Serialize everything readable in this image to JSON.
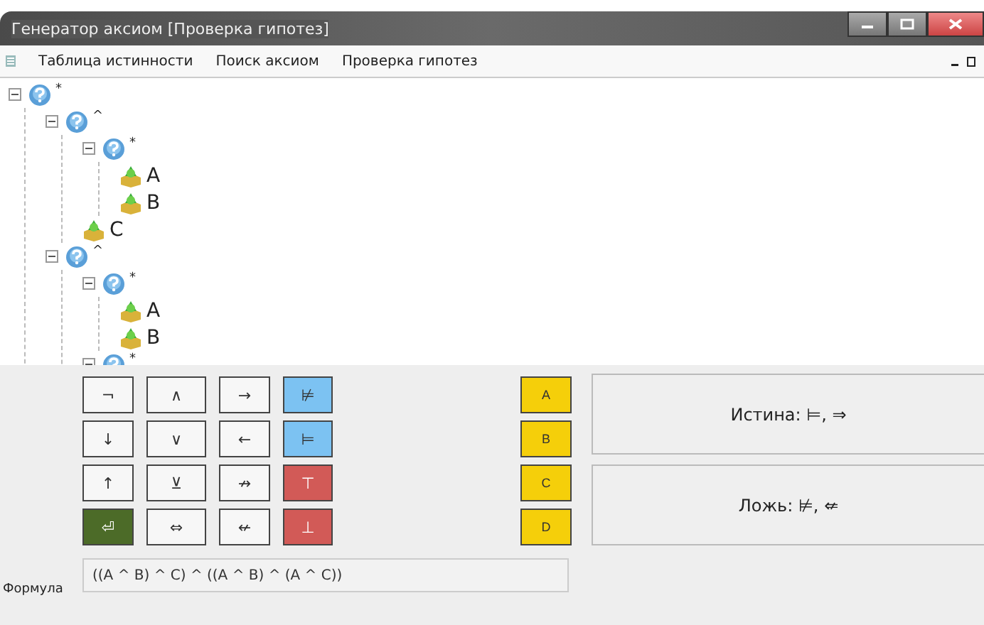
{
  "window": {
    "title": "Генератор аксиом  [Проверка гипотез]"
  },
  "menu": {
    "items": [
      {
        "label": "Таблица истинности"
      },
      {
        "label": "Поиск аксиом"
      },
      {
        "label": "Проверка гипотез"
      }
    ]
  },
  "tree": [
    {
      "kind": "operator",
      "label": "*",
      "expanded": true,
      "children": [
        {
          "kind": "operator",
          "label": "^",
          "expanded": true,
          "children": [
            {
              "kind": "operator",
              "label": "*",
              "expanded": true,
              "children": [
                {
                  "kind": "variable",
                  "label": "A"
                },
                {
                  "kind": "variable",
                  "label": "B"
                }
              ]
            },
            {
              "kind": "variable",
              "label": "C"
            }
          ]
        },
        {
          "kind": "operator",
          "label": "^",
          "expanded": true,
          "children": [
            {
              "kind": "operator",
              "label": "*",
              "expanded": true,
              "children": [
                {
                  "kind": "variable",
                  "label": "A"
                },
                {
                  "kind": "variable",
                  "label": "B"
                }
              ]
            },
            {
              "kind": "operator",
              "label": "*",
              "expanded": true
            }
          ]
        }
      ]
    }
  ],
  "keypad": [
    {
      "label": "¬",
      "kind": "operator"
    },
    {
      "label": "∧",
      "kind": "operator"
    },
    {
      "label": "→",
      "kind": "operator"
    },
    {
      "label": "⊭",
      "kind": "relation"
    },
    {
      "label": "↓",
      "kind": "operator"
    },
    {
      "label": "∨",
      "kind": "operator"
    },
    {
      "label": "←",
      "kind": "operator"
    },
    {
      "label": "⊨",
      "kind": "relation"
    },
    {
      "label": "↑",
      "kind": "operator"
    },
    {
      "label": "⊻",
      "kind": "operator"
    },
    {
      "label": "↛",
      "kind": "operator"
    },
    {
      "label": "⊤",
      "kind": "constant"
    },
    {
      "label": "⏎",
      "kind": "enter"
    },
    {
      "label": "⇔",
      "kind": "operator"
    },
    {
      "label": "↚",
      "kind": "operator"
    },
    {
      "label": "⊥",
      "kind": "constant"
    }
  ],
  "variables": [
    "A",
    "B",
    "C",
    "D"
  ],
  "results": [
    "Истина: ⊨, ⇒",
    "Ложь: ⊭, ⇍"
  ],
  "formula": {
    "label": "Формула",
    "value": "((A ^ B) ^ C) ^ ((A ^ B) ^ (A ^ C))"
  }
}
